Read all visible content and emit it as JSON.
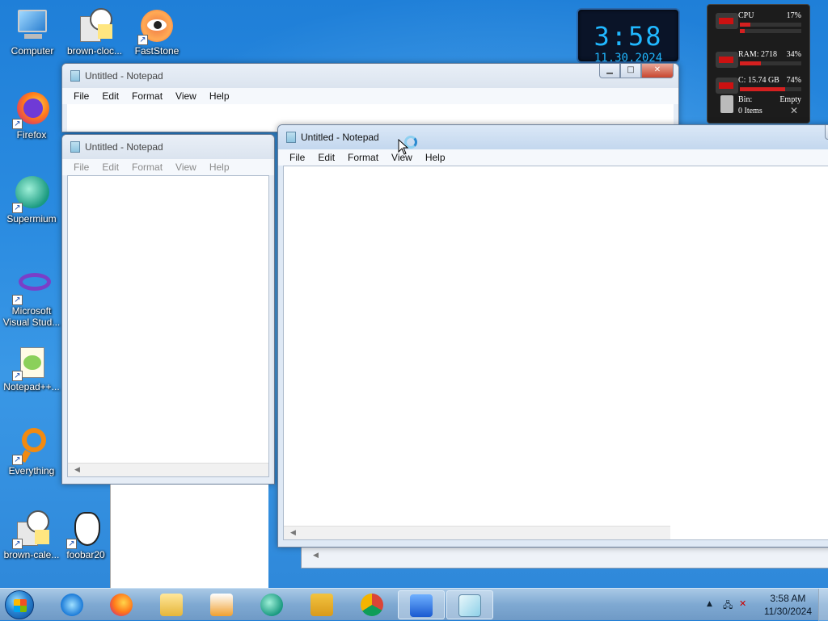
{
  "desktop": {
    "icons": [
      {
        "label": "Computer",
        "icon": "computer-icon"
      },
      {
        "label": "brown-cloc...",
        "icon": "clock-calculator-icon"
      },
      {
        "label": "FastStone",
        "icon": "faststone-eye-icon"
      },
      {
        "label": "Firefox",
        "icon": "firefox-icon"
      },
      {
        "label": "Supermium",
        "icon": "supermium-icon"
      },
      {
        "label": "Microsoft Visual Stud...",
        "icon": "visual-studio-icon"
      },
      {
        "label": "Notepad++...",
        "icon": "notepadpp-icon"
      },
      {
        "label": "Everything",
        "icon": "everything-search-icon"
      },
      {
        "label": "brown-cale...",
        "icon": "calendar-clock-icon"
      },
      {
        "label": "foobar20",
        "icon": "foobar-icon"
      }
    ]
  },
  "clock_gadget": {
    "time": "3:58",
    "date": "11.30.2024"
  },
  "meter_gadget": {
    "cpu_label": "CPU",
    "cpu_value": "17%",
    "cpu_fraction": 0.17,
    "ram_label": "RAM: 2718",
    "ram_value": "34%",
    "ram_fraction": 0.34,
    "disk_label": "C:",
    "disk_size": "15.74 GB",
    "disk_value": "74%",
    "disk_fraction": 0.74,
    "bin_label": "Bin:",
    "bin_status": "Empty",
    "bin_items": "0 Items"
  },
  "windows": [
    {
      "title": "Untitled - Notepad",
      "state": "inactive"
    },
    {
      "title": "Untitled - Notepad",
      "state": "inactive"
    },
    {
      "title": "Untitled - Notepad",
      "state": "active"
    }
  ],
  "menu": {
    "file": "File",
    "edit": "Edit",
    "format": "Format",
    "view": "View",
    "help": "Help"
  },
  "taskbar": {
    "items": [
      {
        "icon": "internet-explorer-icon"
      },
      {
        "icon": "firefox-icon"
      },
      {
        "icon": "file-explorer-icon"
      },
      {
        "icon": "media-player-icon"
      },
      {
        "icon": "supermium-icon"
      },
      {
        "icon": "save-disk-icon"
      },
      {
        "icon": "chrome-icon"
      },
      {
        "icon": "app-blue-icon"
      },
      {
        "icon": "notepad-icon"
      }
    ],
    "clock_time": "3:58 AM",
    "clock_date": "11/30/2024"
  }
}
